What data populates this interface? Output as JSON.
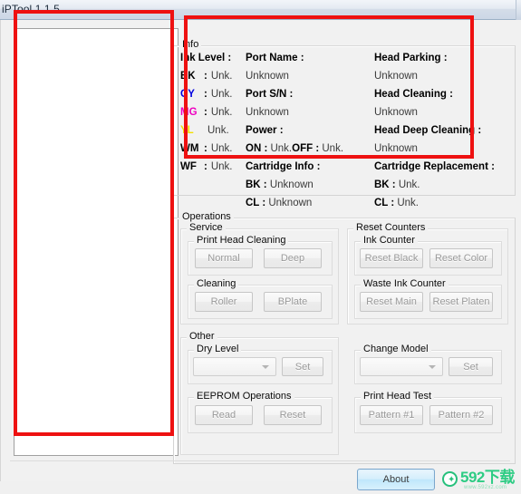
{
  "window": {
    "title": "iPTool 1.1.5"
  },
  "log": {
    "content": ""
  },
  "info": {
    "group_label": "Info",
    "ink_level_label": "Ink Level :",
    "ink_levels": [
      {
        "key": "BK",
        "sep": ":",
        "value": "Unk.",
        "color": "#000000"
      },
      {
        "key": "CY",
        "sep": ":",
        "value": "Unk.",
        "color": "#0000e0"
      },
      {
        "key": "MG",
        "sep": ":",
        "value": "Unk.",
        "color": "#ee00c0"
      },
      {
        "key": "YL",
        "sep": "",
        "value": "Unk.",
        "color": "#f2e000"
      },
      {
        "key": "WM",
        "sep": ":",
        "value": "Unk.",
        "color": "#000000"
      },
      {
        "key": "WF",
        "sep": ":",
        "value": "Unk.",
        "color": "#000000"
      }
    ],
    "port_name_label": "Port Name :",
    "port_name_value": "Unknown",
    "port_sn_label": "Port S/N :",
    "port_sn_value": "Unknown",
    "power_label": "Power :",
    "power_on_label": "ON :",
    "power_on_value": "Unk.",
    "power_off_label": "OFF :",
    "power_off_value": "Unk.",
    "cartridge_info_label": "Cartridge Info :",
    "cartridge_bk_label": "BK :",
    "cartridge_bk_value": "Unknown",
    "cartridge_cl_label": "CL :",
    "cartridge_cl_value": "Unknown",
    "head_parking_label": "Head Parking :",
    "head_parking_value": "Unknown",
    "head_cleaning_label": "Head Cleaning :",
    "head_cleaning_value": "Unknown",
    "head_deep_cleaning_label": "Head Deep Cleaning :",
    "head_deep_cleaning_value": "Unknown",
    "cartridge_replacement_label": "Cartridge Replacement :",
    "replacement_bk_label": "BK :",
    "replacement_bk_value": "Unk.",
    "replacement_cl_label": "CL :",
    "replacement_cl_value": "Unk."
  },
  "operations": {
    "group_label": "Operations",
    "service": {
      "group_label": "Service",
      "print_head_cleaning_label": "Print Head Cleaning",
      "normal_button": "Normal",
      "deep_button": "Deep",
      "cleaning_label": "Cleaning",
      "roller_button": "Roller",
      "bplate_button": "BPlate"
    },
    "reset_counters": {
      "group_label": "Reset Counters",
      "ink_counter_label": "Ink Counter",
      "reset_black_button": "Reset Black",
      "reset_color_button": "Reset Color",
      "waste_ink_counter_label": "Waste Ink Counter",
      "reset_main_button": "Reset Main",
      "reset_platen_button": "Reset Platen"
    },
    "other": {
      "group_label": "Other",
      "dry_level_label": "Dry Level",
      "dry_level_value": "",
      "dry_level_set_button": "Set",
      "eeprom_label": "EEPROM Operations",
      "read_button": "Read",
      "reset_button": "Reset"
    },
    "right_other": {
      "change_model_label": "Change Model",
      "change_model_value": "",
      "change_model_set_button": "Set",
      "print_head_test_label": "Print Head Test",
      "pattern1_button": "Pattern #1",
      "pattern2_button": "Pattern #2"
    }
  },
  "footer": {
    "about_button": "About",
    "watermark_text": "592下载",
    "watermark_url": "www.592xz.com",
    "watermark_color": "#2ecc84"
  },
  "annotations": {
    "color": "#ee1111",
    "boxes": [
      {
        "name": "log-panel-highlight"
      },
      {
        "name": "info-panel-highlight"
      }
    ]
  }
}
